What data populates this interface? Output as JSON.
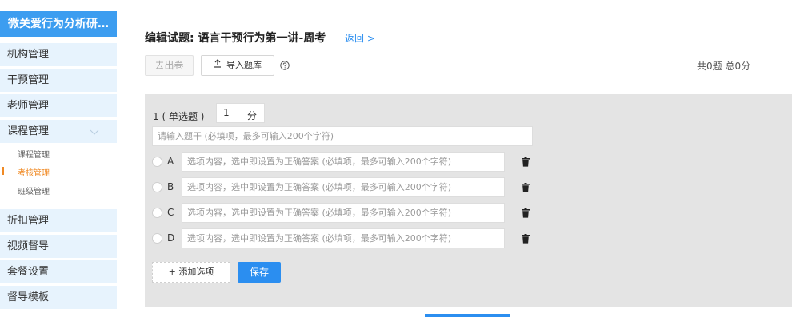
{
  "sidebar": {
    "brand": "微关爱行为分析研…",
    "items": [
      {
        "label": "机构管理"
      },
      {
        "label": "干预管理"
      },
      {
        "label": "老师管理"
      },
      {
        "label": "课程管理"
      },
      {
        "label": "折扣管理"
      },
      {
        "label": "视频督导"
      },
      {
        "label": "套餐设置"
      },
      {
        "label": "督导模板"
      }
    ],
    "sub_items": [
      {
        "label": "课程管理",
        "active": false
      },
      {
        "label": "考核管理",
        "active": true
      },
      {
        "label": "班级管理",
        "active": false
      }
    ],
    "accent_color": "#3c9df0",
    "active_color": "#f08a24"
  },
  "header": {
    "title": "编辑试题: 语言干预行为第一讲-周考",
    "back_label": "返回 >"
  },
  "toolbar": {
    "out_label": "去出卷",
    "import_label": "导入题库",
    "import_icon": "upload-icon",
    "help_icon": "help-icon",
    "summary": "共0题 总0分"
  },
  "question": {
    "number_type": "1 ( 单选题 )",
    "score_value": "1",
    "score_unit": "分",
    "stem_placeholder": "请输入题干 (必填项，最多可输入200个字符)",
    "options": [
      {
        "letter": "A",
        "placeholder": "选项内容，选中即设置为正确答案 (必填项，最多可输入200个字符)"
      },
      {
        "letter": "B",
        "placeholder": "选项内容，选中即设置为正确答案 (必填项，最多可输入200个字符)"
      },
      {
        "letter": "C",
        "placeholder": "选项内容，选中即设置为正确答案 (必填项，最多可输入200个字符)"
      },
      {
        "letter": "D",
        "placeholder": "选项内容，选中即设置为正确答案 (必填项，最多可输入200个字符)"
      }
    ],
    "add_option_label": "+ 添加选项",
    "save_label": "保存"
  }
}
